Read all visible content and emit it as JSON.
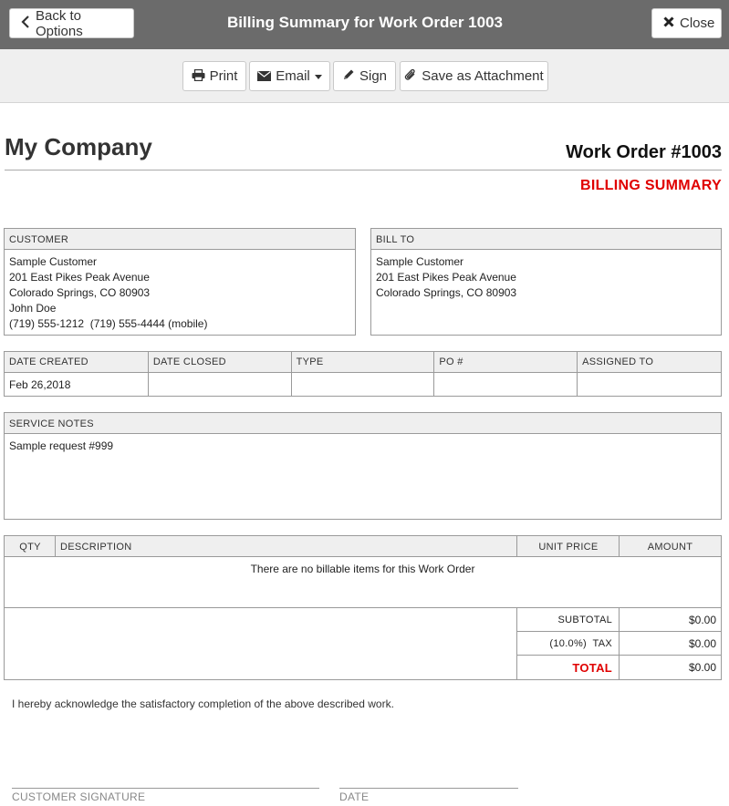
{
  "header": {
    "back_label": "Back to Options",
    "title": "Billing Summary for Work Order 1003",
    "close_label": "Close"
  },
  "toolbar": {
    "print_label": "Print",
    "email_label": "Email",
    "sign_label": "Sign",
    "attach_label": "Save as Attachment"
  },
  "document": {
    "company": "My Company",
    "work_order": "Work Order #1003",
    "doc_type": "BILLING SUMMARY",
    "customer": {
      "header": "CUSTOMER",
      "lines": [
        "Sample Customer",
        "201 East Pikes Peak Avenue",
        "Colorado Springs, CO 80903",
        "John Doe",
        "(719) 555-1212  (719) 555-4444 (mobile)"
      ]
    },
    "bill_to": {
      "header": "BILL TO",
      "lines": [
        "Sample Customer",
        "201 East Pikes Peak Avenue",
        "Colorado Springs, CO 80903"
      ]
    },
    "info_table": {
      "headers": [
        "DATE CREATED",
        "DATE CLOSED",
        "TYPE",
        "PO #",
        "ASSIGNED TO"
      ],
      "values": [
        "Feb 26,2018",
        "",
        "",
        "",
        ""
      ]
    },
    "service_notes": {
      "header": "SERVICE NOTES",
      "text": "Sample request #999"
    },
    "items": {
      "headers": [
        "QTY",
        "DESCRIPTION",
        "UNIT PRICE",
        "AMOUNT"
      ],
      "empty_message": "There are no billable items for this Work Order",
      "subtotal_label": "SUBTOTAL",
      "subtotal_value": "$0.00",
      "tax_label": "(10.0%)  TAX",
      "tax_value": "$0.00",
      "total_label": "TOTAL",
      "total_value": "$0.00"
    },
    "acknowledgement": "I hereby acknowledge the satisfactory completion of the above described work.",
    "customer_signature_label": "CUSTOMER SIGNATURE",
    "date_label": "DATE"
  },
  "colors": {
    "header_bg": "#6b6b6b",
    "toolbar_bg": "#efefef",
    "accent_red": "#e00000"
  },
  "icons": {
    "back": "chevron-left-icon",
    "close": "x-icon",
    "print": "printer-icon",
    "email": "envelope-icon",
    "sign": "pencil-icon",
    "attach": "paperclip-icon"
  }
}
